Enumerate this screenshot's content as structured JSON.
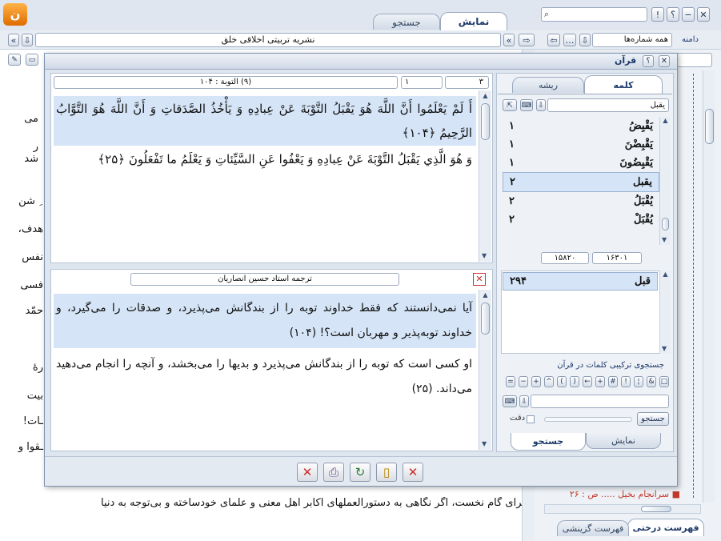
{
  "top": {
    "tab_show": "نمایش",
    "tab_search": "جستجو",
    "window_buttons": [
      "✕",
      "−",
      "؟",
      "!"
    ]
  },
  "toolbar": {
    "publication": "نشریه تربیتی اخلاقی خلق",
    "domain_label": "دامنه",
    "domain_value": "همه شماره‌ها"
  },
  "background_lines": [
    "می",
    "ر شد",
    "ِ شن",
    "هدف،",
    "نفس",
    "فسی",
    "حمّد",
    "رهٔ",
    "بیت",
    "ـات!",
    "ـقوا و"
  ],
  "bottom_line": "برای گام نخست، اگر نگاهی به دستورالعملهای اکابر اهل معنی و علمای خودساخته و بی‌توجه به دنیا",
  "right_panel": {
    "item": "سرانجام بخیل ..... ص : ۲۶",
    "tab_tree": "فهرست درختی",
    "tab_select": "فهرست گزینشی"
  },
  "dialog": {
    "title": "قرآن",
    "verse_ref": "(۹) التوبة : ۱۰۴",
    "field_a": "۱",
    "field_b": "۳",
    "verse_1": "أَ لَمْ يَعْلَمُوا أَنَّ اللَّهَ هُوَ يَقْبَلُ التَّوْبَةَ عَنْ عِبادِهِ وَ يَأْخُذُ الصَّدَقاتِ وَ أَنَّ اللَّهَ هُوَ التَّوَّابُ الرَّحِيمُ ﴿۱۰۴﴾",
    "verse_2": "وَ هُوَ الَّذِي يَقْبَلُ التَّوْبَةَ عَنْ عِبادِهِ وَ يَعْفُوا عَنِ السَّيِّئاتِ وَ يَعْلَمُ ما تَفْعَلُونَ ﴿۲۵﴾",
    "translator": "ترجمه استاد حسین انصاریان",
    "trans_1": "آیا نمی‌دانستند که فقط خداوند توبه را از بندگانش می‌پذیرد، و صدقات را می‌گیرد، و خداوند توبه‌پذیر و مهربان است؟! (۱۰۴)",
    "trans_2": "او کسی است که توبه را از بندگانش می‌پذیرد و بدیها را می‌بخشد، و آنچه را انجام می‌دهید می‌داند. (۲۵)",
    "tab_word": "کلمه",
    "tab_root": "ریشه",
    "search_word": "يقبل",
    "words": [
      {
        "w": "يَقْبِضُ",
        "n": "۱"
      },
      {
        "w": "يَقْبِضْنَ",
        "n": "۱"
      },
      {
        "w": "يَقْبِضُونَ",
        "n": "۱"
      },
      {
        "w": "يقبل",
        "n": "۲"
      },
      {
        "w": "يُقْبَلُ",
        "n": "۲"
      },
      {
        "w": "يُقْبَلْ",
        "n": "۲"
      }
    ],
    "count_a": "۱۶۳۰۱",
    "count_b": "۱۵۸۲۰",
    "root_word": "قبل",
    "root_count": "۲۹۴",
    "combo_title": "جستجوی ترکیبی کلمات در قرآن",
    "symbols": [
      "□",
      "&",
      "¦",
      "!",
      "#",
      "+",
      "←",
      "(",
      ")",
      "^",
      "+",
      "−",
      "="
    ],
    "accuracy": "دقت",
    "search_btn": "جستجو",
    "bottom_tab_show": "نمایش",
    "bottom_tab_search": "جستجو",
    "footer_buttons": [
      "✕",
      "⎙",
      "↻",
      "▯",
      "✕"
    ]
  },
  "colors": {
    "highlight_word": "#2e8b1f",
    "accent": "#1e3a6a",
    "error": "#cc2a2a"
  }
}
